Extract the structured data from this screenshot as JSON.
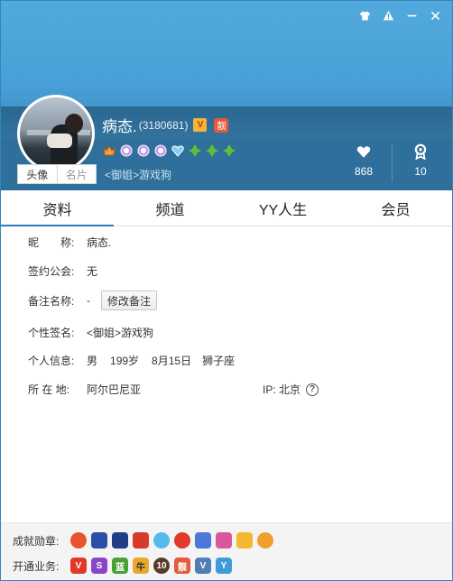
{
  "header": {
    "name": "病态.",
    "uid": "(3180681)",
    "vip_badge": "V",
    "liang_badge": "靓",
    "signature": "<御姐>游戏狗",
    "likes": "868",
    "rank": "10"
  },
  "avatar_tabs": [
    "头像",
    "名片"
  ],
  "tabs": [
    "资料",
    "频道",
    "YY人生",
    "会员"
  ],
  "info": {
    "nickname_label": "昵　　称:",
    "nickname": "病态.",
    "guild_label": "签约公会:",
    "guild": "无",
    "remark_label": "备注名称:",
    "remark": "-",
    "remark_button": "修改备注",
    "sign_label": "个性签名:",
    "sign": "<御姐>游戏狗",
    "personal_label": "个人信息:",
    "gender": "男",
    "age": "199岁",
    "birthday": "8月15日",
    "zodiac": "狮子座",
    "location_label": "所 在 地:",
    "location": "阿尔巴尼亚",
    "ip": "IP: 北京",
    "help": "?"
  },
  "bottom": {
    "medals_label": "成就勋章:",
    "services_label": "开通业务:",
    "service_badges": [
      "V",
      "S",
      "蓝",
      "牛",
      "10",
      "靓",
      "V",
      "Y"
    ]
  }
}
